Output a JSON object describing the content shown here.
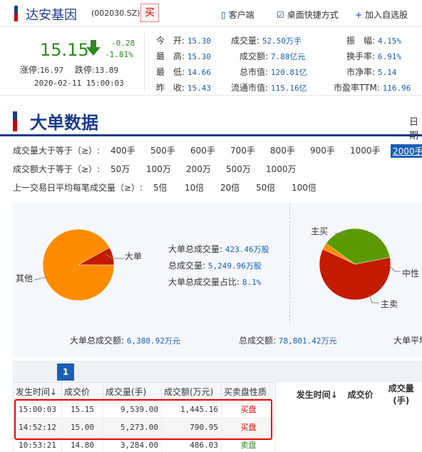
{
  "stock": {
    "name": "达安基因",
    "code": "(002030.SZ)",
    "buy_label": "买",
    "links": [
      "客户端",
      "桌面快捷方式",
      "加入自选股"
    ]
  },
  "quote": {
    "price": "15.15",
    "change": "-0.28",
    "change_pct": "-1.81%",
    "limit_up_label": "涨停:",
    "limit_up": "16.97",
    "limit_down_label": "跌停:",
    "limit_down": "13.89",
    "datetime": "2020-02-11 15:00:03",
    "col1": [
      {
        "label": "今　开:",
        "value": "15.30"
      },
      {
        "label": "最　高:",
        "value": "15.30"
      },
      {
        "label": "最　低:",
        "value": "14.66"
      },
      {
        "label": "昨　收:",
        "value": "15.43"
      }
    ],
    "col2": [
      {
        "label": "成交量:",
        "value": "52.50万手"
      },
      {
        "label": "成交额:",
        "value": "7.88亿元"
      },
      {
        "label": "总市值:",
        "value": "120.81亿"
      },
      {
        "label": "流通市值:",
        "value": "115.16亿"
      }
    ],
    "col3": [
      {
        "label": "振　幅:",
        "value": "4.15%"
      },
      {
        "label": "换手率:",
        "value": "6.91%"
      },
      {
        "label": "市净率:",
        "value": "5.14"
      },
      {
        "label": "市盈率TTM:",
        "value": "116.96"
      }
    ]
  },
  "section": {
    "title": "大单数据",
    "right_text": "日期"
  },
  "filters": {
    "vol_label": "成交量大于等于（≥）:",
    "vol_options": [
      "400手",
      "500手",
      "600手",
      "700手",
      "800手",
      "900手",
      "1000手",
      "2000手"
    ],
    "vol_selected": "2000手",
    "amt_label": "成交额大于等于（≥）:",
    "amt_options": [
      "50万",
      "100万",
      "200万",
      "500万",
      "1000万"
    ],
    "avg_label": "上一交易日平均每笔成交量（≥）:",
    "avg_options": [
      "5倍",
      "10倍",
      "20倍",
      "50倍",
      "100倍"
    ]
  },
  "stats": {
    "big_vol_label": "大单总成交量:",
    "big_vol": "423.46万股",
    "total_vol_label": "总成交量:",
    "total_vol": "5,249.96万股",
    "ratio_label": "大单总成交量占比:",
    "ratio": "8.1%",
    "big_amt_label": "大单总成交额:",
    "big_amt": "6,380.92万元",
    "total_amt_label": "总成交额:",
    "total_amt": "78,801.42万元",
    "avg_label": "大单平均"
  },
  "pie1": {
    "slices": [
      {
        "name": "大单",
        "pct": 8.1,
        "color": "#c41a00"
      },
      {
        "name": "其他",
        "pct": 91.9,
        "color": "#ff8c00"
      }
    ]
  },
  "pie2": {
    "slices": [
      {
        "name": "主买",
        "pct": 60,
        "color": "#c41a00"
      },
      {
        "name": "中性",
        "pct": 3,
        "color": "#ff8c00"
      },
      {
        "name": "主卖",
        "pct": 37,
        "color": "#5a9a00"
      }
    ]
  },
  "pager": {
    "page": "1"
  },
  "table": {
    "headers": [
      "发生时间↓",
      "成交价",
      "成交量(手)",
      "成交额(万元)",
      "买卖盘性质"
    ],
    "rows": [
      [
        "15:00:03",
        "15.15",
        "9,539.00",
        "1,445.16",
        "买盘"
      ],
      [
        "14:52:12",
        "15.00",
        "5,273.00",
        "790.95",
        "买盘"
      ],
      [
        "10:53:21",
        "14.80",
        "3,284.00",
        "486.03",
        "卖盘"
      ]
    ]
  },
  "table2": {
    "headers": [
      "发生时间↓",
      "成交价",
      "成交量(手)"
    ]
  }
}
